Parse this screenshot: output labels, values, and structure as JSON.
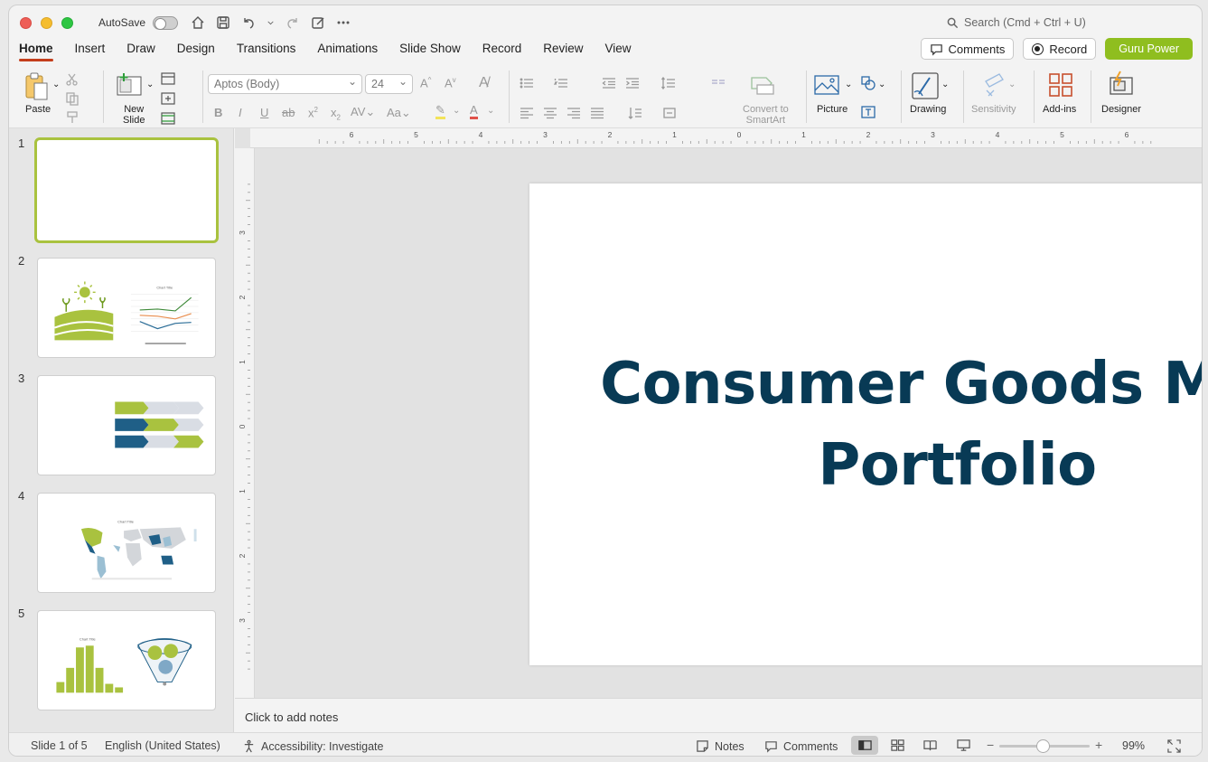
{
  "titlebar": {
    "autosave_label": "AutoSave",
    "search_placeholder": "Search (Cmd + Ctrl + U)"
  },
  "tabs": [
    "Home",
    "Insert",
    "Draw",
    "Design",
    "Transitions",
    "Animations",
    "Slide Show",
    "Record",
    "Review",
    "View"
  ],
  "header_buttons": {
    "comments": "Comments",
    "record": "Record",
    "guru": "Guru Power"
  },
  "ribbon": {
    "paste": "Paste",
    "new_slide_line1": "New",
    "new_slide_line2": "Slide",
    "font_name": "Aptos (Body)",
    "font_size": "24",
    "convert_line1": "Convert to",
    "convert_line2": "SmartArt",
    "picture": "Picture",
    "drawing": "Drawing",
    "sensitivity": "Sensitivity",
    "addins": "Add-ins",
    "designer": "Designer"
  },
  "ruler": {
    "h_labels": [
      "6",
      "5",
      "4",
      "3",
      "2",
      "1",
      "0",
      "1",
      "2",
      "3",
      "4",
      "5",
      "6"
    ],
    "v_labels": [
      "3",
      "2",
      "1",
      "0",
      "1",
      "2",
      "3"
    ]
  },
  "slides": [
    {
      "number": "1"
    },
    {
      "number": "2",
      "chart_title": "Chart Title"
    },
    {
      "number": "3"
    },
    {
      "number": "4",
      "chart_title": "Chart Title"
    },
    {
      "number": "5",
      "chart_title": "Chart Title"
    }
  ],
  "slide": {
    "title_line1": "Consumer Goods M&A",
    "title_line2": "Portfolio"
  },
  "notes_placeholder": "Click to add notes",
  "status": {
    "slide_of": "Slide 1 of 5",
    "language": "English (United States)",
    "accessibility": "Accessibility: Investigate",
    "notes": "Notes",
    "comments": "Comments",
    "zoom": "99%"
  },
  "colors": {
    "accent_tab": "#c43e1c",
    "guru_button": "#8fbe1f",
    "title_color": "#083a55",
    "slide_green": "#a9c23f",
    "slide_blue": "#1f5f87"
  }
}
